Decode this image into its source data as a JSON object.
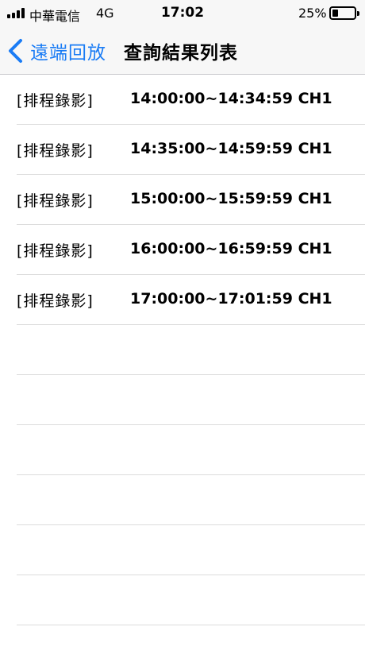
{
  "status_bar": {
    "carrier": "中華電信",
    "network": "4G",
    "time": "17:02",
    "battery_percent": "25%"
  },
  "nav": {
    "back_label": "遠端回放",
    "title": "查詢結果列表"
  },
  "results": [
    {
      "tag": "[排程錄影]",
      "time": "14:00:00~14:34:59 CH1"
    },
    {
      "tag": "[排程錄影]",
      "time": "14:35:00~14:59:59 CH1"
    },
    {
      "tag": "[排程錄影]",
      "time": "15:00:00~15:59:59 CH1"
    },
    {
      "tag": "[排程錄影]",
      "time": "16:00:00~16:59:59 CH1"
    },
    {
      "tag": "[排程錄影]",
      "time": "17:00:00~17:01:59 CH1"
    }
  ],
  "colors": {
    "accent": "#1a7cf5",
    "bar_background": "#f7f7f7",
    "separator": "#dcdcdc"
  },
  "icons": [
    "cellular-signal-icon",
    "battery-icon",
    "chevron-left-icon"
  ]
}
